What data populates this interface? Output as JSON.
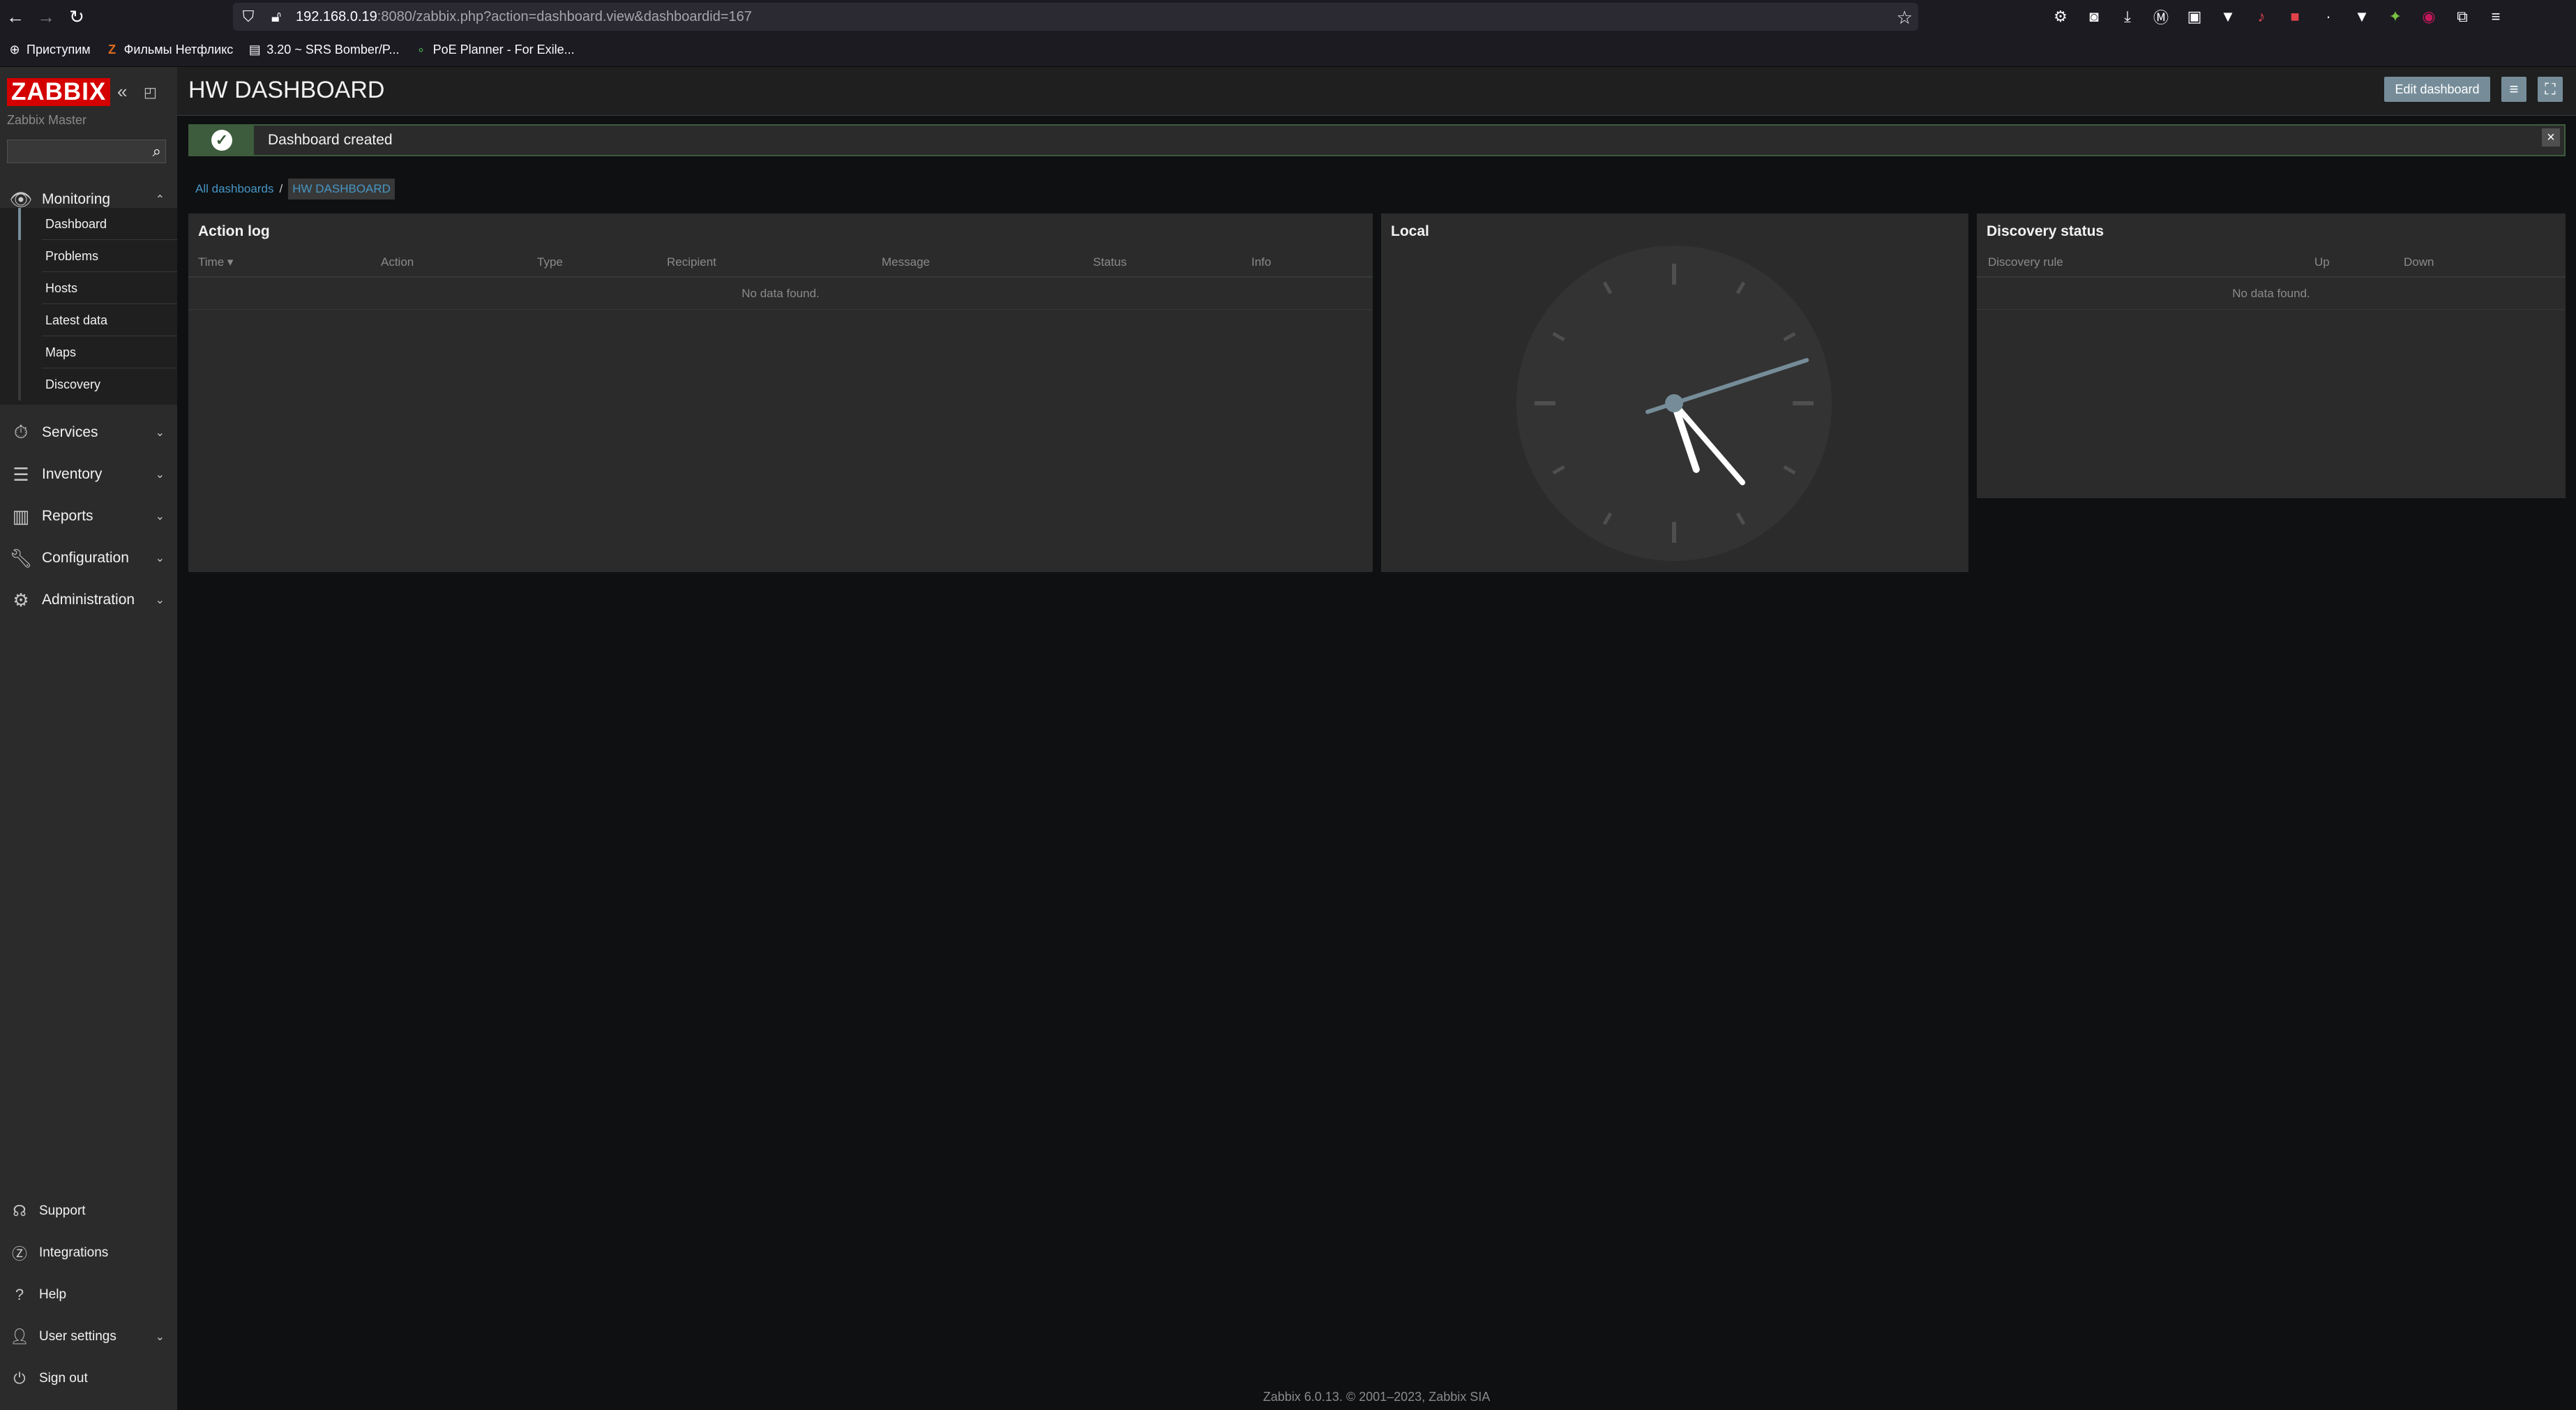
{
  "browser": {
    "url_host": "192.168.0.19",
    "url_rest": ":8080/zabbix.php?action=dashboard.view&dashboardid=167",
    "bookmarks": [
      "Приступим",
      "Фильмы Нетфликс",
      "3.20 ~ SRS Bomber/P...",
      "PoE Planner - For Exile..."
    ]
  },
  "sidebar": {
    "logo": "ZABBIX",
    "server_name": "Zabbix Master",
    "search_placeholder": "",
    "sections": [
      {
        "label": "Monitoring",
        "icon": "eye-icon"
      },
      {
        "label": "Services",
        "icon": "stopwatch-icon"
      },
      {
        "label": "Inventory",
        "icon": "list-icon"
      },
      {
        "label": "Reports",
        "icon": "bar-chart-icon"
      },
      {
        "label": "Configuration",
        "icon": "wrench-icon"
      },
      {
        "label": "Administration",
        "icon": "gear-icon"
      }
    ],
    "monitoring_items": [
      "Dashboard",
      "Problems",
      "Hosts",
      "Latest data",
      "Maps",
      "Discovery"
    ],
    "footer_items": [
      {
        "label": "Support",
        "icon": "headset-icon"
      },
      {
        "label": "Integrations",
        "icon": "z-icon"
      },
      {
        "label": "Help",
        "icon": "question-icon"
      },
      {
        "label": "User settings",
        "icon": "user-icon"
      },
      {
        "label": "Sign out",
        "icon": "power-icon"
      }
    ]
  },
  "header": {
    "title": "HW DASHBOARD",
    "edit_label": "Edit dashboard"
  },
  "message": {
    "text": "Dashboard created"
  },
  "breadcrumb": {
    "root": "All dashboards",
    "separator": "/",
    "current": "HW DASHBOARD"
  },
  "widgets": {
    "action_log": {
      "title": "Action log",
      "columns": [
        "Time ▾",
        "Action",
        "Type",
        "Recipient",
        "Message",
        "Status",
        "Info"
      ],
      "empty": "No data found."
    },
    "clock": {
      "title": "Local",
      "hour": 5,
      "minute": 23,
      "second": 12
    },
    "discovery": {
      "title": "Discovery status",
      "columns": [
        "Discovery rule",
        "Up",
        "Down"
      ],
      "empty": "No data found."
    }
  },
  "footer": "Zabbix 6.0.13. © 2001–2023, Zabbix SIA"
}
